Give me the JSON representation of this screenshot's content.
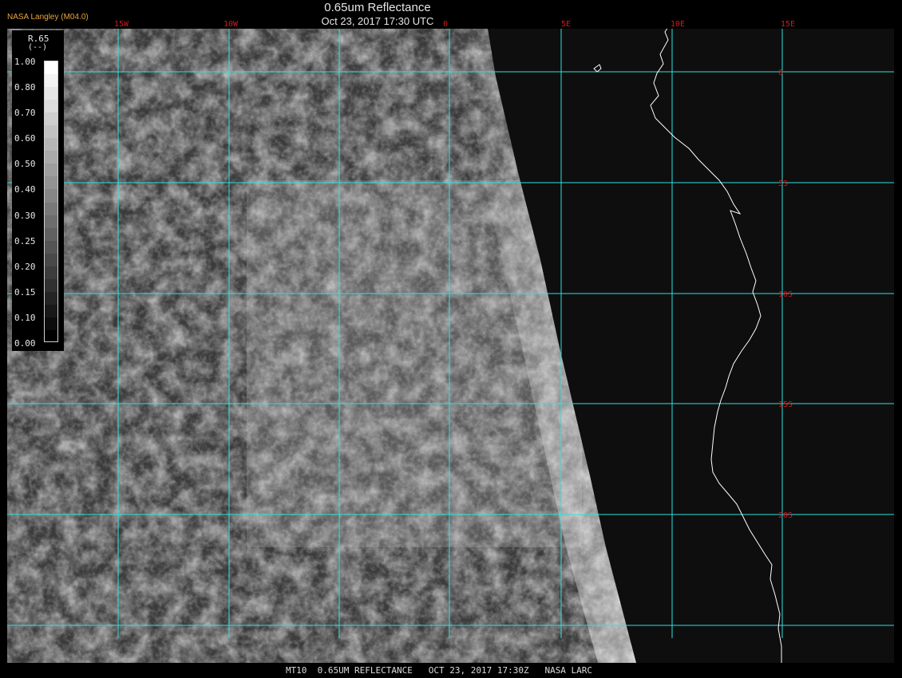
{
  "header": {
    "organization": "NASA Langley (M04.0)",
    "title": "0.65um Reflectance",
    "datetime": "Oct 23, 2017 17:30 UTC"
  },
  "legend": {
    "variable": "R.65",
    "unit": "(--)",
    "labels": [
      "1.00",
      "0.80",
      "0.70",
      "0.60",
      "0.50",
      "0.40",
      "0.30",
      "0.25",
      "0.20",
      "0.15",
      "0.10",
      "0.00"
    ]
  },
  "map": {
    "grid_color": "#2fe0e0",
    "label_color": "#d11a1a",
    "coast_color": "#ffffff",
    "lon_labels": [
      "15W",
      "10W",
      "0",
      "5E",
      "10E",
      "15E"
    ],
    "lat_labels": [
      "0",
      "5S",
      "10S",
      "15S",
      "20S"
    ]
  },
  "footer": {
    "caption": "MT10  0.65UM REFLECTANCE   OCT 23, 2017 17:30Z   NASA LARC"
  }
}
